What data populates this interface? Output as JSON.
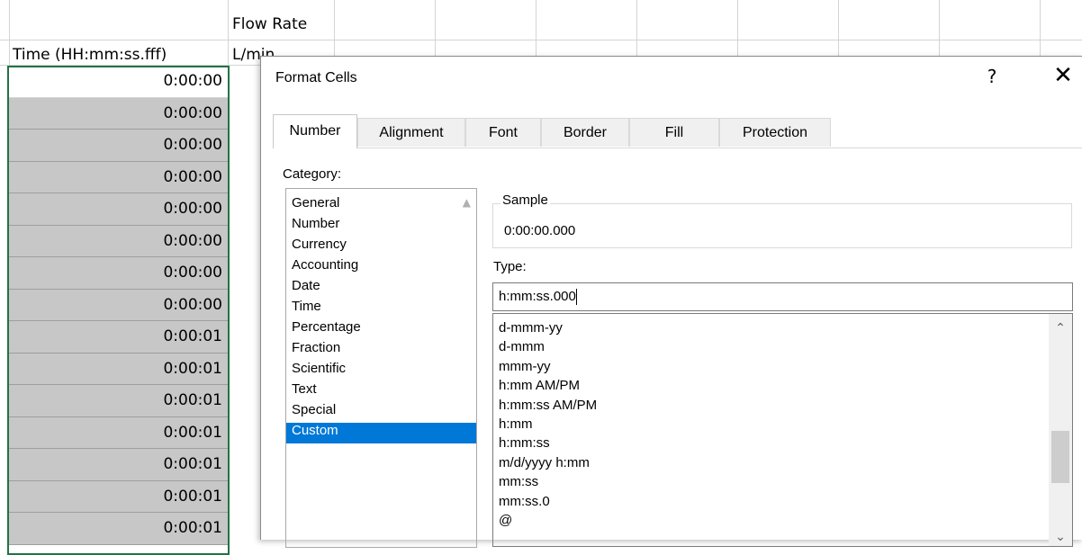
{
  "sheet": {
    "header_col_b": "Flow Rate",
    "header_col_a": "Time (HH:mm:ss.fff)",
    "unit_col_b": "L/min",
    "time_values": [
      "0:00:00",
      "0:00:00",
      "0:00:00",
      "0:00:00",
      "0:00:00",
      "0:00:00",
      "0:00:00",
      "0:00:00",
      "0:00:01",
      "0:00:01",
      "0:00:01",
      "0:00:01",
      "0:00:01",
      "0:00:01",
      "0:00:01"
    ],
    "selection_color": "#217346"
  },
  "dialog": {
    "title": "Format Cells",
    "help": "?",
    "close": "✕",
    "tabs": [
      "Number",
      "Alignment",
      "Font",
      "Border",
      "Fill",
      "Protection"
    ],
    "category_label": "Category:",
    "categories": [
      "General",
      "Number",
      "Currency",
      "Accounting",
      "Date",
      "Time",
      "Percentage",
      "Fraction",
      "Scientific",
      "Text",
      "Special",
      "Custom"
    ],
    "selected_category": "Custom",
    "sample_label": "Sample",
    "sample_value": "0:00:00.000",
    "type_label": "Type:",
    "type_value": "h:mm:ss.000",
    "formats": [
      "d-mmm-yy",
      "d-mmm",
      "mmm-yy",
      "h:mm AM/PM",
      "h:mm:ss AM/PM",
      "h:mm",
      "h:mm:ss",
      "m/d/yyyy h:mm",
      "mm:ss",
      "mm:ss.0",
      "@"
    ],
    "accent_color": "#0078d7"
  }
}
